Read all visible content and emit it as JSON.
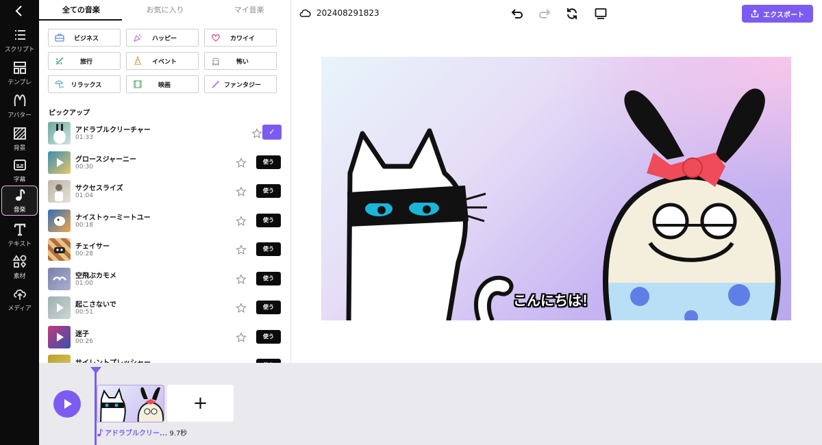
{
  "rail": {
    "items": [
      {
        "label": "スクリプト",
        "icon": "list-icon"
      },
      {
        "label": "テンプレ",
        "icon": "template-icon"
      },
      {
        "label": "アバター",
        "icon": "avatar-icon"
      },
      {
        "label": "背景",
        "icon": "background-icon"
      },
      {
        "label": "字幕",
        "icon": "subtitle-icon"
      },
      {
        "label": "音楽",
        "icon": "music-note-icon",
        "active": true
      },
      {
        "label": "テキスト",
        "icon": "text-icon"
      },
      {
        "label": "素材",
        "icon": "shapes-icon"
      },
      {
        "label": "メディア",
        "icon": "cloud-upload-icon"
      }
    ]
  },
  "panel": {
    "tabs": [
      "全ての音楽",
      "お気に入り",
      "マイ音楽"
    ],
    "categories": [
      "ビジネス",
      "ハッピー",
      "カワイイ",
      "旅行",
      "イベント",
      "怖い",
      "リラックス",
      "映画",
      "ファンタジー"
    ],
    "pickup_title": "ピックアップ",
    "use_label": "使う",
    "selected_mark": "✓",
    "tracks": [
      {
        "name": "アドラブルクリーチャー",
        "duration": "01:33",
        "selected": true
      },
      {
        "name": "グロースジャーニー",
        "duration": "00:30"
      },
      {
        "name": "サクセスライズ",
        "duration": "01:04"
      },
      {
        "name": "ナイストゥーミートユー",
        "duration": "00:18"
      },
      {
        "name": "チェイサー",
        "duration": "00:28"
      },
      {
        "name": "空飛ぶカモメ",
        "duration": "01:00"
      },
      {
        "name": "起こさないで",
        "duration": "00:51"
      },
      {
        "name": "迷子",
        "duration": "00:26"
      },
      {
        "name": "サイレントプレッシャー",
        "duration": ""
      }
    ]
  },
  "topbar": {
    "project_name": "202408291823",
    "export_label": "エクスポート"
  },
  "canvas": {
    "subtitle": "こんにちは！"
  },
  "timeline": {
    "add_label": "+",
    "music_name": "アドラブルクリー...",
    "music_length": "9.7秒"
  },
  "colors": {
    "accent": "#7c5cf0",
    "rail_bg": "#0c0c0c",
    "timeline_bg": "#e9e9ee"
  }
}
